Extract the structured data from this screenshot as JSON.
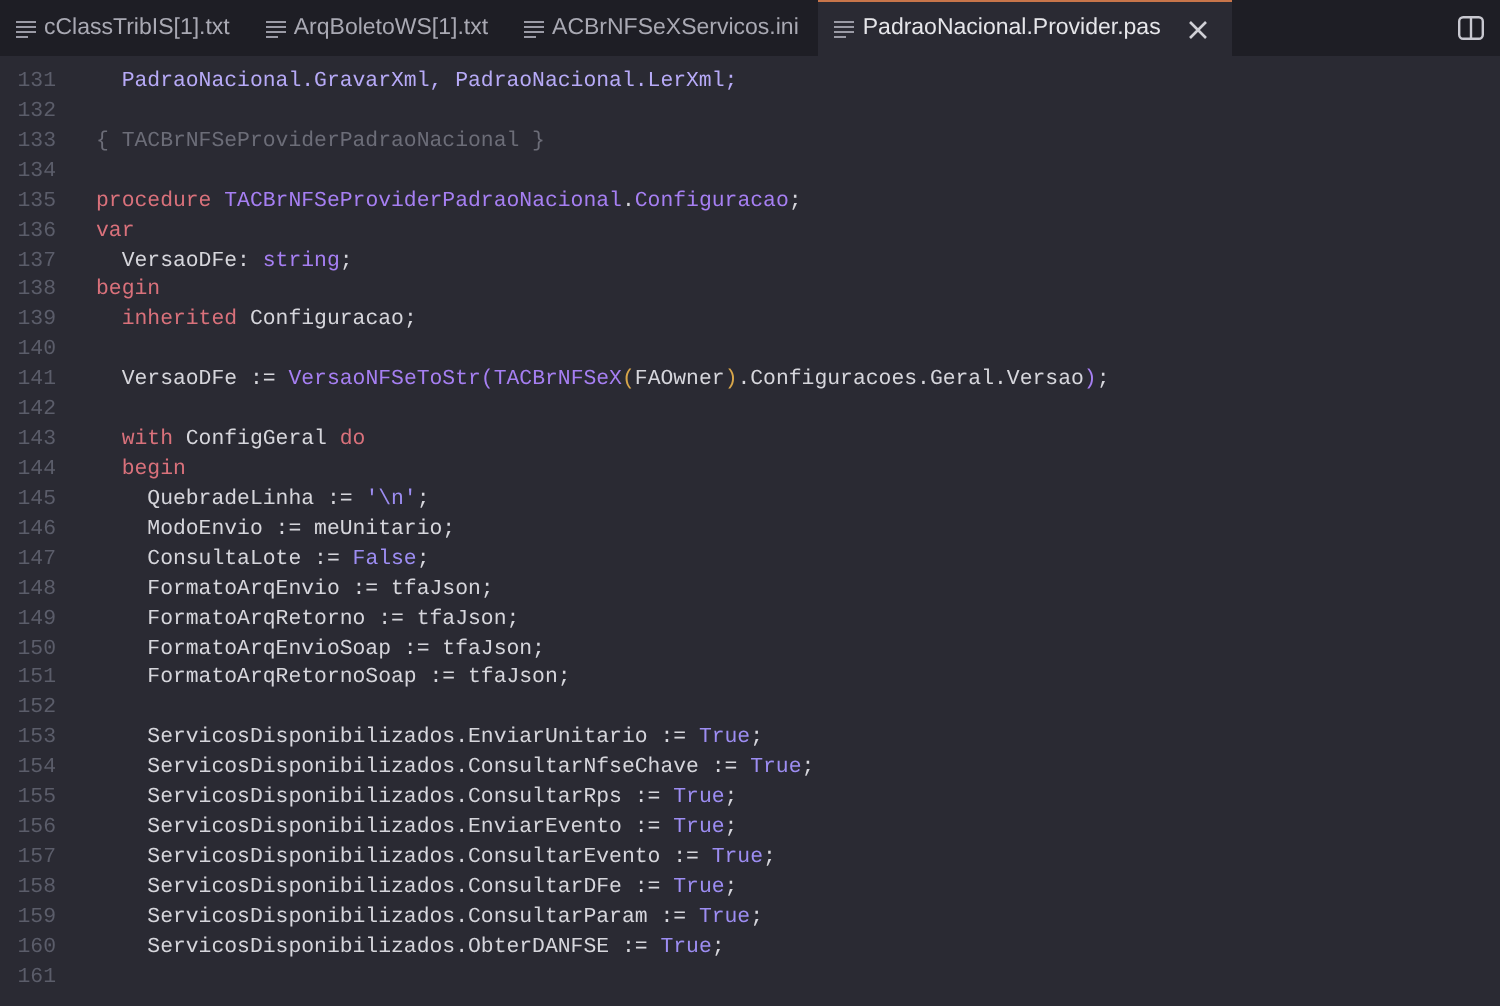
{
  "tabs": [
    {
      "label": "cClassTribIS[1].txt",
      "selected": false
    },
    {
      "label": "ArqBoletoWS[1].txt",
      "selected": false
    },
    {
      "label": "ACBrNFSeXServicos.ini",
      "selected": false
    },
    {
      "label": "PadraoNacional.Provider.pas",
      "selected": true
    }
  ],
  "editor": {
    "lines": [
      {
        "number": "131",
        "tokens": [
          {
            "text": "  PadraoNacional.GravarXml, PadraoNacional.LerXml;",
            "kind": "unit"
          }
        ]
      },
      {
        "number": "132"
      },
      {
        "number": "133",
        "tokens": [
          {
            "text": "{ TACBrNFSeProviderPadraoNacional }",
            "kind": "comment"
          }
        ]
      },
      {
        "number": "134"
      },
      {
        "number": "135",
        "tokens": [
          {
            "text": "procedure ",
            "kind": "keyword"
          },
          {
            "text": "TACBrNFSeProviderPadraoNacional",
            "kind": "type"
          },
          {
            "text": ".",
            "kind": "plain"
          },
          {
            "text": "Configuracao",
            "kind": "type"
          },
          {
            "text": ";",
            "kind": "plain"
          }
        ]
      },
      {
        "number": "136",
        "tokens": [
          {
            "text": "var",
            "kind": "keyword"
          }
        ]
      },
      {
        "number": "137",
        "tokens": [
          {
            "text": "  VersaoDFe: ",
            "kind": "plain"
          },
          {
            "text": "string",
            "kind": "type"
          },
          {
            "text": ";",
            "kind": "plain"
          }
        ]
      },
      {
        "number": "138",
        "tokens": [
          {
            "text": "begin",
            "kind": "keyword"
          }
        ]
      },
      {
        "number": "139",
        "tokens": [
          {
            "text": "  inherited",
            "kind": "keyword"
          },
          {
            "text": " Configuracao;",
            "kind": "plain"
          }
        ]
      },
      {
        "number": "140"
      },
      {
        "number": "141",
        "tokens": [
          {
            "text": "  VersaoDFe := ",
            "kind": "plain"
          },
          {
            "text": "VersaoNFSeToStr(TACBrNFSeX",
            "kind": "type"
          },
          {
            "text": "(",
            "kind": "paren"
          },
          {
            "text": "FAOwner",
            "kind": "plain"
          },
          {
            "text": ")",
            "kind": "paren"
          },
          {
            "text": ".Configuracoes.Geral.Versao",
            "kind": "plain"
          },
          {
            "text": ")",
            "kind": "type"
          },
          {
            "text": ";",
            "kind": "plain"
          }
        ]
      },
      {
        "number": "142"
      },
      {
        "number": "143",
        "tokens": [
          {
            "text": "  with",
            "kind": "keyword"
          },
          {
            "text": " ConfigGeral ",
            "kind": "plain"
          },
          {
            "text": "do",
            "kind": "keyword"
          }
        ]
      },
      {
        "number": "144",
        "tokens": [
          {
            "text": "  begin",
            "kind": "keyword"
          }
        ]
      },
      {
        "number": "145",
        "tokens": [
          {
            "text": "    QuebradeLinha := ",
            "kind": "plain"
          },
          {
            "text": "'\\n'",
            "kind": "literal"
          },
          {
            "text": ";",
            "kind": "plain"
          }
        ]
      },
      {
        "number": "146",
        "tokens": [
          {
            "text": "    ModoEnvio := meUnitario;",
            "kind": "plain"
          }
        ]
      },
      {
        "number": "147",
        "tokens": [
          {
            "text": "    ConsultaLote := ",
            "kind": "plain"
          },
          {
            "text": "False",
            "kind": "literal"
          },
          {
            "text": ";",
            "kind": "plain"
          }
        ]
      },
      {
        "number": "148",
        "tokens": [
          {
            "text": "    FormatoArqEnvio := tfaJson;",
            "kind": "plain"
          }
        ]
      },
      {
        "number": "149",
        "tokens": [
          {
            "text": "    FormatoArqRetorno := tfaJson;",
            "kind": "plain"
          }
        ]
      },
      {
        "number": "150",
        "tokens": [
          {
            "text": "    FormatoArqEnvioSoap := tfaJson;",
            "kind": "plain"
          }
        ]
      },
      {
        "number": "151",
        "tokens": [
          {
            "text": "    FormatoArqRetornoSoap := tfaJson;",
            "kind": "plain"
          }
        ]
      },
      {
        "number": "152"
      },
      {
        "number": "153",
        "tokens": [
          {
            "text": "    ServicosDisponibilizados.EnviarUnitario := ",
            "kind": "plain"
          },
          {
            "text": "True",
            "kind": "literal"
          },
          {
            "text": ";",
            "kind": "plain"
          }
        ]
      },
      {
        "number": "154",
        "tokens": [
          {
            "text": "    ServicosDisponibilizados.ConsultarNfseChave := ",
            "kind": "plain"
          },
          {
            "text": "True",
            "kind": "literal"
          },
          {
            "text": ";",
            "kind": "plain"
          }
        ]
      },
      {
        "number": "155",
        "tokens": [
          {
            "text": "    ServicosDisponibilizados.ConsultarRps := ",
            "kind": "plain"
          },
          {
            "text": "True",
            "kind": "literal"
          },
          {
            "text": ";",
            "kind": "plain"
          }
        ]
      },
      {
        "number": "156",
        "tokens": [
          {
            "text": "    ServicosDisponibilizados.EnviarEvento := ",
            "kind": "plain"
          },
          {
            "text": "True",
            "kind": "literal"
          },
          {
            "text": ";",
            "kind": "plain"
          }
        ]
      },
      {
        "number": "157",
        "tokens": [
          {
            "text": "    ServicosDisponibilizados.ConsultarEvento := ",
            "kind": "plain"
          },
          {
            "text": "True",
            "kind": "literal"
          },
          {
            "text": ";",
            "kind": "plain"
          }
        ]
      },
      {
        "number": "158",
        "tokens": [
          {
            "text": "    ServicosDisponibilizados.ConsultarDFe := ",
            "kind": "plain"
          },
          {
            "text": "True",
            "kind": "literal"
          },
          {
            "text": ";",
            "kind": "plain"
          }
        ]
      },
      {
        "number": "159",
        "tokens": [
          {
            "text": "    ServicosDisponibilizados.ConsultarParam := ",
            "kind": "plain"
          },
          {
            "text": "True",
            "kind": "literal"
          },
          {
            "text": ";",
            "kind": "plain"
          }
        ]
      },
      {
        "number": "160",
        "tokens": [
          {
            "text": "    ServicosDisponibilizados.ObterDANFSE := ",
            "kind": "plain"
          },
          {
            "text": "True",
            "kind": "literal"
          },
          {
            "text": ";",
            "kind": "plain"
          }
        ]
      },
      {
        "number": "161"
      }
    ]
  }
}
